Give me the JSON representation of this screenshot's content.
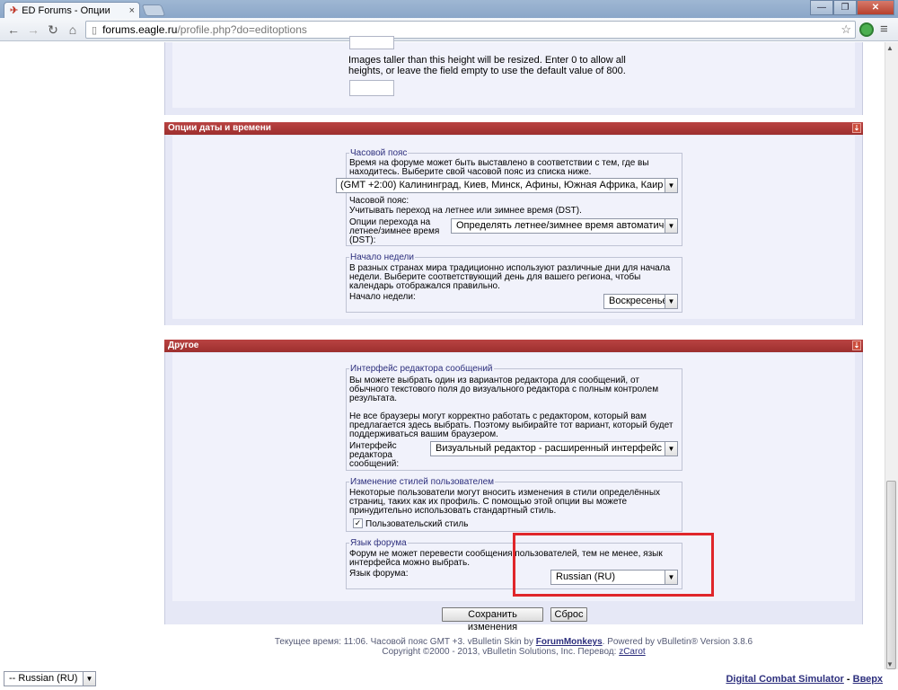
{
  "browser": {
    "tab_title": "ED Forums - Опции",
    "tab_close": "×",
    "window_minimize": "—",
    "window_maximize": "❐",
    "window_close": "✕",
    "url_host": "forums.eagle.ru",
    "url_path": "/profile.php?do=editoptions"
  },
  "image_section": {
    "help_text_line1": "Images taller than this height will be resized. Enter 0 to allow all",
    "help_text_line2": "heights, or leave the field empty to use the default value of 800."
  },
  "datetime": {
    "header": "Опции даты и времени",
    "timezone": {
      "legend": "Часовой пояс",
      "desc_line1": "Время на форуме может быть выставлено в соответствии с тем, где вы",
      "desc_line2": "находитесь. Выберите свой часовой пояс из списка ниже.",
      "selected": "(GMT +2:00) Калининград, Киев, Минск, Афины, Южная Африка, Каир",
      "label": "Часовой пояс:",
      "dst_note": "Учитывать переход на летнее или зимнее время (DST).",
      "dst_label_line1": "Опции перехода на",
      "dst_label_line2": "летнее/зимнее время",
      "dst_label_line3": "(DST):",
      "dst_selected": "Определять летнее/зимнее время автоматически"
    },
    "week": {
      "legend": "Начало недели",
      "desc_line1": "В разных странах мира традиционно используют различные дни для начала",
      "desc_line2": "недели. Выберите соответствующий день для вашего региона, чтобы",
      "desc_line3": "календарь отображался правильно.",
      "label": "Начало недели:",
      "selected": "Воскресенье"
    }
  },
  "other": {
    "header": "Другое",
    "editor": {
      "legend": "Интерфейс редактора сообщений",
      "desc_line1": "Вы можете выбрать один из вариантов редактора для сообщений, от",
      "desc_line2": "обычного текстового поля до визуального редактора с полным контролем",
      "desc_line3": "результата.",
      "desc_line4": "Не все браузеры могут корректно работать с редактором, который вам",
      "desc_line5": "предлагается здесь выбрать. Поэтому выбирайте тот вариант, который будет",
      "desc_line6": "поддерживаться вашим браузером.",
      "label_line1": "Интерфейс",
      "label_line2": "редактора",
      "label_line3": "сообщений:",
      "selected": "Визуальный редактор - расширенный интерфейс"
    },
    "styles": {
      "legend": "Изменение стилей пользователем",
      "desc_line1": "Некоторые пользователи могут вносить изменения в стили определённых",
      "desc_line2": "страниц, таких как их профиль. С помощью этой опции вы можете",
      "desc_line3": "принудительно использовать стандартный стиль.",
      "checkbox_label": "Пользовательский стиль",
      "checked": true
    },
    "language": {
      "legend": "Язык форума",
      "desc_line1": "Форум не может перевести сообщения пользователей, тем не менее, язык",
      "desc_line2": "интерфейса можно выбрать.",
      "label": "Язык форума:",
      "selected": "Russian (RU)"
    }
  },
  "buttons": {
    "save": "Сохранить изменения",
    "reset": "Сброс"
  },
  "footer": {
    "line1_pre": "Текущее время: 11:06. Часовой пояс GMT +3. vBulletin Skin by",
    "skin_author": "ForumMonkeys",
    "line1_post": ". Powered by vBulletin® Version 3.8.6",
    "line2_pre": "Copyright ©2000 - 2013, vBulletin Solutions, Inc. Перевод:",
    "translator": "zCarot"
  },
  "bottom": {
    "language_select": "-- Russian (RU)",
    "site_link": "Digital Combat Simulator",
    "separator": " - ",
    "top_link": "Вверх"
  },
  "colors": {
    "section_header": "#b13b3a",
    "panel_bg": "#e6e8f6",
    "highlight_box": "#e0262a",
    "legend_text": "#2d2f7d"
  }
}
